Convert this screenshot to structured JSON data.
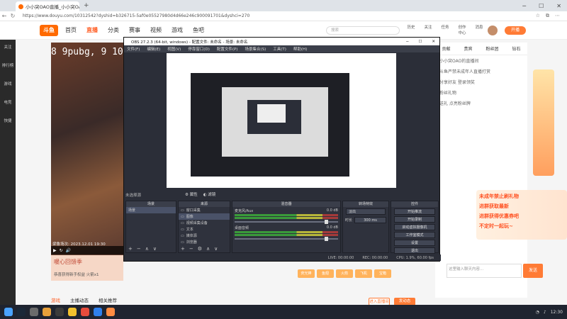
{
  "browser": {
    "tab_title": "小小突OAO直播_小小突OAO视频",
    "url": "https://www.douyu.com/10312542?dyshid=b326715-5af0e05527980d4d66e246c900091701&dyshci=270"
  },
  "douyu": {
    "logo": "斗鱼",
    "nav": [
      "首页",
      "直播",
      "分类",
      "赛事",
      "视频",
      "游戏",
      "鱼吧"
    ],
    "search_placeholder": "搜索",
    "icons": [
      "历史",
      "关注",
      "任务",
      "创作中心",
      "消息"
    ],
    "live_button": "开播",
    "side": [
      "关注",
      "排行榜",
      "游戏",
      "电竞",
      "快捷"
    ],
    "video_text": "8 9pubg, 9 10",
    "video_time": "梁鲁场次: 2023.12.01 19:30",
    "promo_text": "暖心回馈季",
    "promo_small": "恭喜获得新手权益 火箭x1",
    "below_tabs": [
      "游戏",
      "主播动态",
      "相关推荐"
    ],
    "right_tabs": [
      "贡献",
      "贵宾",
      "粉丝团",
      "钻石"
    ],
    "right_list": [
      "小小突OAO的直播间",
      "斗鱼严禁未成年人直播打赏",
      "分享好友 登录领奖",
      "粉丝礼物",
      "送礼 点亮粉丝牌"
    ],
    "ad_lines": [
      "未成年禁止刷礼物",
      "进群获取最新",
      "进群获得优惠券吧",
      "不定时一起玩~"
    ],
    "chat_placeholder": "这里输入聊天内容...",
    "send": "发送",
    "gift_labels": [
      "荧光棒",
      "鱼翅",
      "火箭",
      "飞机",
      "宝箱"
    ],
    "bottom_buttons": [
      "进入直播间",
      "发动态"
    ]
  },
  "obs": {
    "title": "OBS 27.2.3 (64-bit, windows) - 配置文件: 未命名 - 场景: 未命名",
    "menu": [
      "文件(F)",
      "编辑(E)",
      "视图(V)",
      "停靠窗口(D)",
      "配置文件(P)",
      "场景集合(S)",
      "工具(T)",
      "帮助(H)"
    ],
    "scene_label": "未选择源",
    "ctrl_props": "属性",
    "ctrl_filters": "滤镜",
    "docks": {
      "scenes": "场景",
      "sources": "来源",
      "mixer": "混音器",
      "transitions": "转场特效",
      "controls": "控件"
    },
    "scenes_list": [
      "场景"
    ],
    "sources_list": [
      "窗口采集",
      "图像",
      "视频采集设备",
      "文本",
      "媒体源",
      "浏览器",
      "显示器采集"
    ],
    "mixer": [
      {
        "name": "桌面音频",
        "db": "0.0 dB"
      },
      {
        "name": "麦克风/Aux",
        "db": "0.0 dB"
      }
    ],
    "transition_type": "淡出",
    "transition_duration_label": "时长",
    "transition_duration": "300 ms",
    "controls": [
      "开始推流",
      "开始录制",
      "启动虚拟摄像机",
      "工作室模式",
      "设置",
      "退出"
    ],
    "status": {
      "live": "LIVE: 00:00:00",
      "rec": "REC: 00:00:00",
      "cpu": "CPU: 1.9%, 60.00 fps"
    }
  },
  "taskbar": {
    "clock": "12:30",
    "date": "2023/12/1"
  }
}
